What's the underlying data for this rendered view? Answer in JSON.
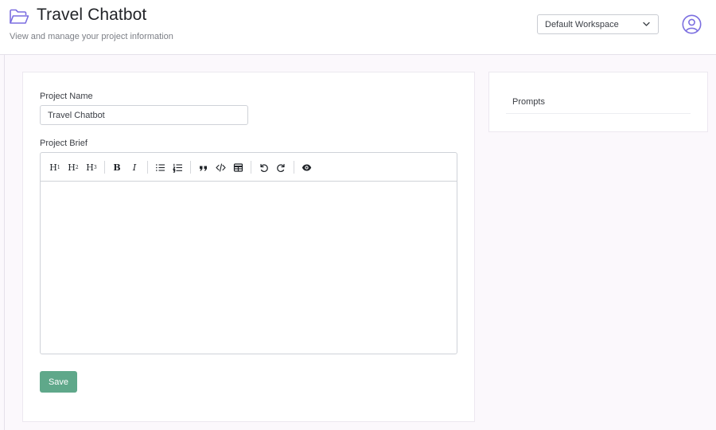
{
  "header": {
    "title": "Travel Chatbot",
    "subtitle": "View and manage your project information",
    "workspace_select": {
      "selected": "Default Workspace"
    },
    "accent_color": "#7b6ee0"
  },
  "project_form": {
    "name_label": "Project Name",
    "name_value": "Travel Chatbot",
    "brief_label": "Project Brief",
    "brief_value": "",
    "toolbar": {
      "groups": [
        [
          "heading-1",
          "heading-2",
          "heading-3"
        ],
        [
          "bold",
          "italic"
        ],
        [
          "bullet-list",
          "ordered-list"
        ],
        [
          "blockquote",
          "code",
          "table"
        ],
        [
          "undo",
          "redo"
        ],
        [
          "preview"
        ]
      ],
      "h1_glyph": "H",
      "h1_sub": "1",
      "h2_glyph": "H",
      "h2_sub": "2",
      "h3_glyph": "H",
      "h3_sub": "3",
      "bold_glyph": "B",
      "italic_glyph": "I"
    },
    "save_label": "Save",
    "save_color": "#5fa88a"
  },
  "sidebar": {
    "prompts_title": "Prompts"
  }
}
